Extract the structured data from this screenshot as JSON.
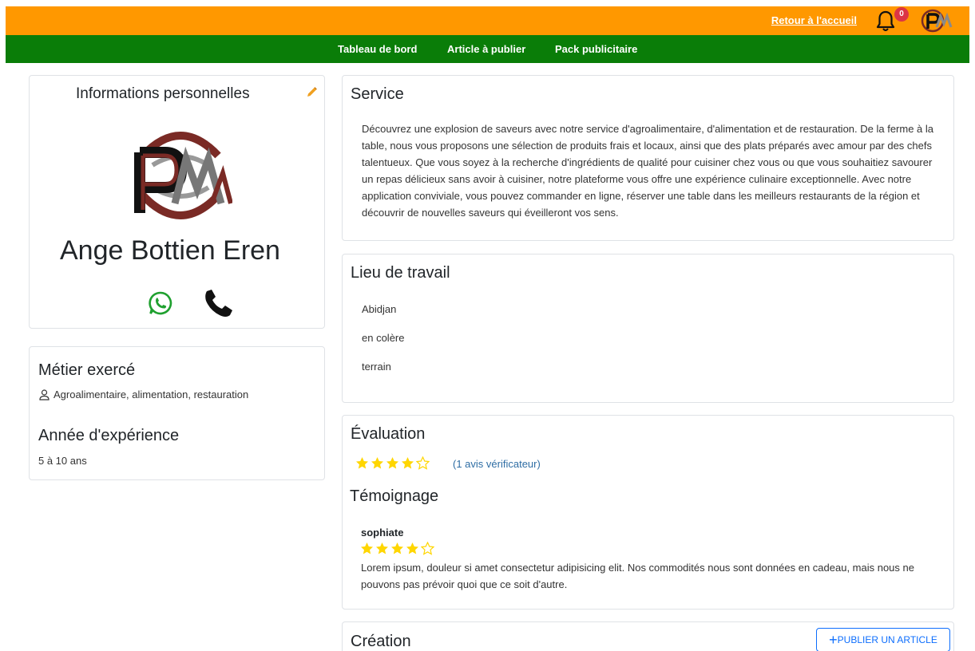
{
  "topbar": {
    "home_link": "Retour à l'accueil",
    "notification_count": "0",
    "bg_color": "#ff9800"
  },
  "nav": {
    "items": [
      "Tableau de bord",
      "Article à publier",
      "Pack publicitaire"
    ],
    "bg_color": "#0a7d08"
  },
  "profile": {
    "title": "Informations personnelles",
    "name": "Ange Bottien Eren",
    "icons": [
      "pencil-icon",
      "whatsapp-icon",
      "phone-icon"
    ]
  },
  "job": {
    "title": "Métier exercé",
    "value": "Agroalimentaire, alimentation, restauration",
    "experience_title": "Année d'expérience",
    "experience_value": "5 à 10 ans"
  },
  "service": {
    "title": "Service",
    "description": "Découvrez une explosion de saveurs avec notre service d'agroalimentaire, d'alimentation et de restauration. De la ferme à la table, nous vous proposons une sélection de produits frais et locaux, ainsi que des plats préparés avec amour par des chefs talentueux. Que vous soyez à la recherche d'ingrédients de qualité pour cuisiner chez vous ou que vous souhaitiez savourer un repas délicieux sans avoir à cuisiner, notre plateforme vous offre une expérience culinaire exceptionnelle. Avec notre application conviviale, vous pouvez commander en ligne, réserver une table dans les meilleurs restaurants de la région et découvrir de nouvelles saveurs qui éveilleront vos sens."
  },
  "workplace": {
    "title": "Lieu de travail",
    "items": [
      "Abidjan",
      "en colère",
      "terrain"
    ]
  },
  "evaluation": {
    "title": "Évaluation",
    "rating": 4,
    "max": 5,
    "count_text": "(1 avis vérificateur)"
  },
  "testimony": {
    "title": "Témoignage",
    "author": "sophiate",
    "rating": 4,
    "max": 5,
    "text": "Lorem ipsum, douleur si amet consectetur adipisicing elit. Nos commodités nous sont données en cadeau, mais nous ne pouvons pas prévoir quoi que ce soit d'autre."
  },
  "creation": {
    "title": "Création",
    "publish_button": "PUBLIER UN ARTICLE"
  },
  "colors": {
    "star": "#ffd600",
    "link": "#2e6da4",
    "accent_blue": "#0d6efd",
    "pencil": "#f0a020"
  }
}
